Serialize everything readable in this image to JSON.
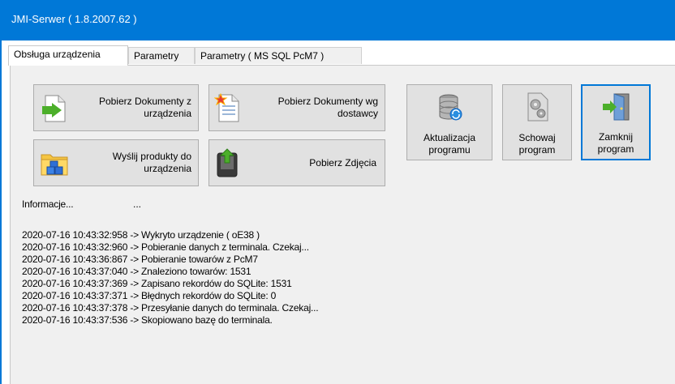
{
  "window": {
    "title": "JMI-Serwer ( 1.8.2007.62 )",
    "accent_color": "#0078d7"
  },
  "tabs": [
    {
      "label": "Obsługa urządzenia",
      "active": true
    },
    {
      "label": "Parametry",
      "active": false
    },
    {
      "label": "Parametry ( MS SQL PcM7 )",
      "active": false
    }
  ],
  "buttons": {
    "pobierz_dokumenty": {
      "label": "Pobierz Dokumenty z urządzenia",
      "line1": "Pobierz Dokumenty z",
      "line2": "urządzenia",
      "icon": "document-arrow-icon"
    },
    "pobierz_dostawcy": {
      "label": "Pobierz Dokumenty wg dostawcy",
      "line1": "Pobierz Dokumenty wg",
      "line2": "dostawcy",
      "icon": "document-star-icon"
    },
    "wyslij_produkty": {
      "label": "Wyślij produkty do urządzenia",
      "line1": "Wyślij produkty do",
      "line2": "urządzenia",
      "icon": "folder-cubes-icon"
    },
    "pobierz_zdjecia": {
      "label": "Pobierz Zdjęcia",
      "icon": "device-upload-icon"
    },
    "aktualizacja": {
      "line1": "Aktualizacja",
      "line2": "programu",
      "icon": "database-refresh-icon"
    },
    "schowaj": {
      "line1": "Schowaj",
      "line2": "program",
      "icon": "gears-icon"
    },
    "zamknij": {
      "line1": "Zamknij",
      "line2": "program",
      "icon": "exit-door-icon"
    }
  },
  "info": {
    "label": "Informacje...",
    "value": "..."
  },
  "log": [
    "2020-07-16 10:43:32:958 -> Wykryto urządzenie ( oE38 )",
    "2020-07-16 10:43:32:960 -> Pobieranie danych z terminala. Czekaj...",
    "2020-07-16 10:43:36:867 -> Pobieranie towarów z PcM7",
    "2020-07-16 10:43:37:040 -> Znaleziono towarów: 1531",
    "2020-07-16 10:43:37:369 -> Zapisano rekordów do SQLite: 1531",
    "2020-07-16 10:43:37:371 -> Błędnych rekordów do SQLite: 0",
    "2020-07-16 10:43:37:378 -> Przesyłanie danych do terminala. Czekaj...",
    "2020-07-16 10:43:37:536 -> Skopiowano bazę do terminala."
  ]
}
